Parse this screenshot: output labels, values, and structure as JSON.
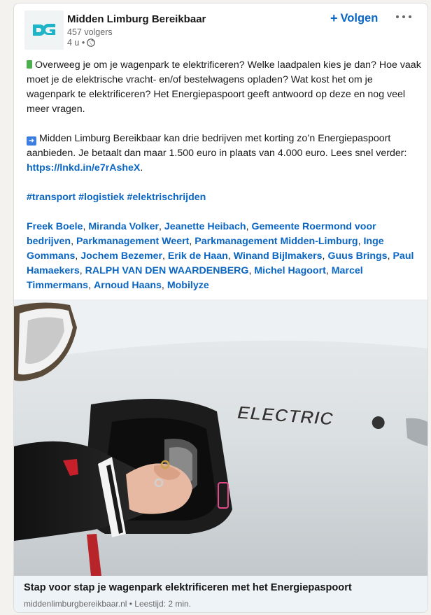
{
  "actor": {
    "name": "Midden Limburg Bereikbaar",
    "followers": "457 volgers",
    "time": "4 u •",
    "logo_text": "DG"
  },
  "actions": {
    "follow_plus": "+",
    "follow_label": "Volgen",
    "more_icon": "more-horizontal-icon"
  },
  "post": {
    "p1": "Overweeg je om je wagenpark te elektrificeren? Welke laadpalen kies je dan? Hoe vaak moet je de elektrische vracht- en/of bestelwagens opladen? Wat kost het om je wagenpark te elektrificeren? Het Energiepaspoort geeft antwoord op deze en nog veel meer vragen.",
    "p2_pre": "Midden Limburg Bereikbaar kan drie bedrijven met korting zo’n Energiepaspoort aanbieden. Je betaalt dan maar 1.500 euro in plaats van 4.000 euro. Lees snel verder: ",
    "p2_link": "https://lnkd.in/e7rAsheX",
    "p2_post": ".",
    "hashtags": [
      "#transport",
      "#logistiek",
      "#elektrischrijden"
    ],
    "mentions": [
      "Freek Boele",
      "Miranda Volker",
      "Jeanette Heibach",
      "Gemeente Roermond voor bedrijven",
      "Parkmanagement Weert",
      "Parkmanagement Midden-Limburg",
      "Inge Gommans",
      "Jochem Bezemer",
      "Erik de Haan",
      "Winand Bijlmakers",
      "Guus Brings",
      "Paul Hamaekers",
      "RALPH VAN DEN WAARDENBERG",
      "Michel Hagoort",
      "Marcel Timmermans",
      "Arnoud Haans",
      "Mobilyze"
    ]
  },
  "image": {
    "car_badge": "ELECTRIC"
  },
  "article": {
    "title": "Stap voor stap je wagenpark elektrificeren met het Energiepaspoort",
    "source": "middenlimburgbereikbaar.nl • Leestijd: 2 min."
  },
  "colors": {
    "link": "#0a66c2",
    "logo": "#1fb5c9"
  }
}
